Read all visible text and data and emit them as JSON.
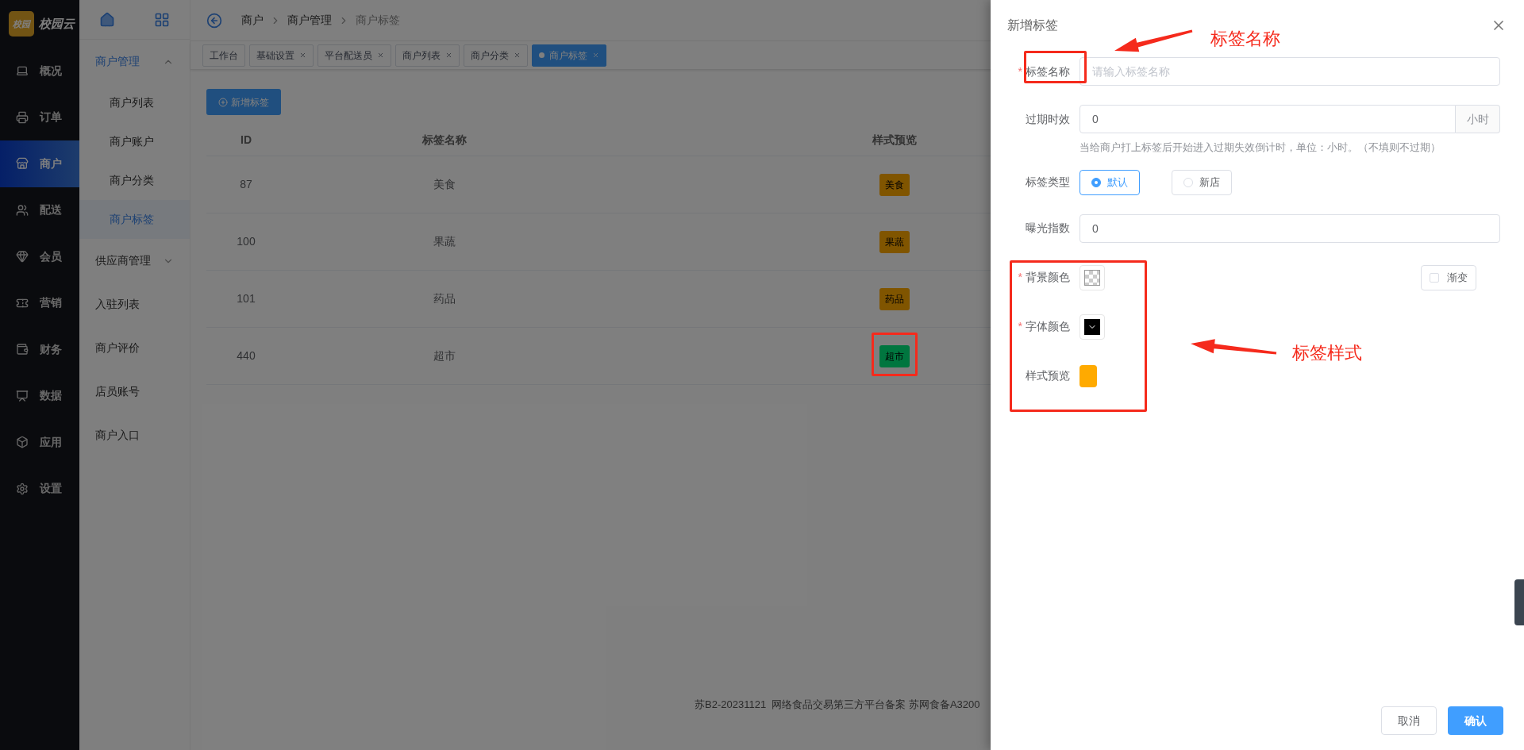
{
  "sidebar": {
    "logo_badge": "校园",
    "logo_text": "校园云",
    "items": [
      {
        "label": "概况",
        "selected": false
      },
      {
        "label": "订单",
        "selected": false
      },
      {
        "label": "商户",
        "selected": true
      },
      {
        "label": "配送",
        "selected": false
      },
      {
        "label": "会员",
        "selected": false
      },
      {
        "label": "营销",
        "selected": false
      },
      {
        "label": "财务",
        "selected": false
      },
      {
        "label": "数据",
        "selected": false
      },
      {
        "label": "应用",
        "selected": false
      },
      {
        "label": "设置",
        "selected": false
      }
    ]
  },
  "submenu": {
    "items": [
      {
        "kind": "group",
        "label": "商户管理",
        "selected": true,
        "expanded": true,
        "children": [
          {
            "label": "商户列表",
            "selected": false
          },
          {
            "label": "商户账户",
            "selected": false
          },
          {
            "label": "商户分类",
            "selected": false
          },
          {
            "label": "商户标签",
            "selected": true
          }
        ]
      },
      {
        "kind": "group",
        "label": "供应商管理",
        "selected": false,
        "expanded": false
      },
      {
        "kind": "link",
        "label": "入驻列表"
      },
      {
        "kind": "link",
        "label": "商户评价"
      },
      {
        "kind": "link",
        "label": "店员账号"
      },
      {
        "kind": "link",
        "label": "商户入口"
      }
    ]
  },
  "breadcrumb": [
    "商户",
    "商户管理",
    "商户标签"
  ],
  "tabs": [
    {
      "label": "工作台",
      "closable": false,
      "selected": false
    },
    {
      "label": "基础设置",
      "closable": true,
      "selected": false
    },
    {
      "label": "平台配送员",
      "closable": true,
      "selected": false
    },
    {
      "label": "商户列表",
      "closable": true,
      "selected": false
    },
    {
      "label": "商户分类",
      "closable": true,
      "selected": false
    },
    {
      "label": "商户标签",
      "closable": true,
      "selected": true
    }
  ],
  "new_button": "新增标签",
  "table": {
    "columns": [
      "ID",
      "标签名称",
      "样式预览"
    ],
    "rows": [
      {
        "id": "87",
        "name": "美食",
        "tag": {
          "text": "美食",
          "color": "#805500"
        }
      },
      {
        "id": "100",
        "name": "果蔬",
        "tag": {
          "text": "果蔬",
          "color": "#805500"
        }
      },
      {
        "id": "101",
        "name": "药品",
        "tag": {
          "text": "药品",
          "color": "#805500"
        }
      },
      {
        "id": "440",
        "name": "超市",
        "tag": {
          "text": "超市",
          "color": "#00763f"
        }
      }
    ]
  },
  "footer": "苏B2-20231121  网络食品交易第三方平台备案 苏网食备A3200",
  "drawer": {
    "title": "新增标签",
    "fields": [
      {
        "kind": "text",
        "label": "标签名称",
        "required_mark": "*",
        "placeholder": "请输入标签名称"
      },
      {
        "kind": "number_unit",
        "label": "过期时效",
        "value": "0",
        "unit": "小时",
        "hint": "当给商户打上标签后开始进入过期失效倒计时，单位：小时。（不填则不过期）"
      },
      {
        "kind": "radio",
        "label": "标签类型",
        "options": [
          {
            "label": "默认",
            "selected": true
          },
          {
            "label": "新店",
            "selected": false
          }
        ]
      },
      {
        "kind": "text",
        "label": "曝光指数",
        "value": "0"
      },
      {
        "kind": "color",
        "label": "背景颜色",
        "required_mark": "*",
        "empty": true,
        "gradient": {
          "label": "渐变",
          "checked": false
        }
      },
      {
        "kind": "color",
        "label": "字体颜色",
        "required_mark": "*",
        "color": "#000000"
      },
      {
        "kind": "preview",
        "label": "样式预览",
        "color": "#ffaa00"
      }
    ],
    "buttons": {
      "cancel": "取消",
      "confirm": "确认"
    }
  },
  "annotations": [
    {
      "kind": "callout",
      "text": "标签名称"
    },
    {
      "kind": "callout",
      "text": "标签样式"
    }
  ]
}
